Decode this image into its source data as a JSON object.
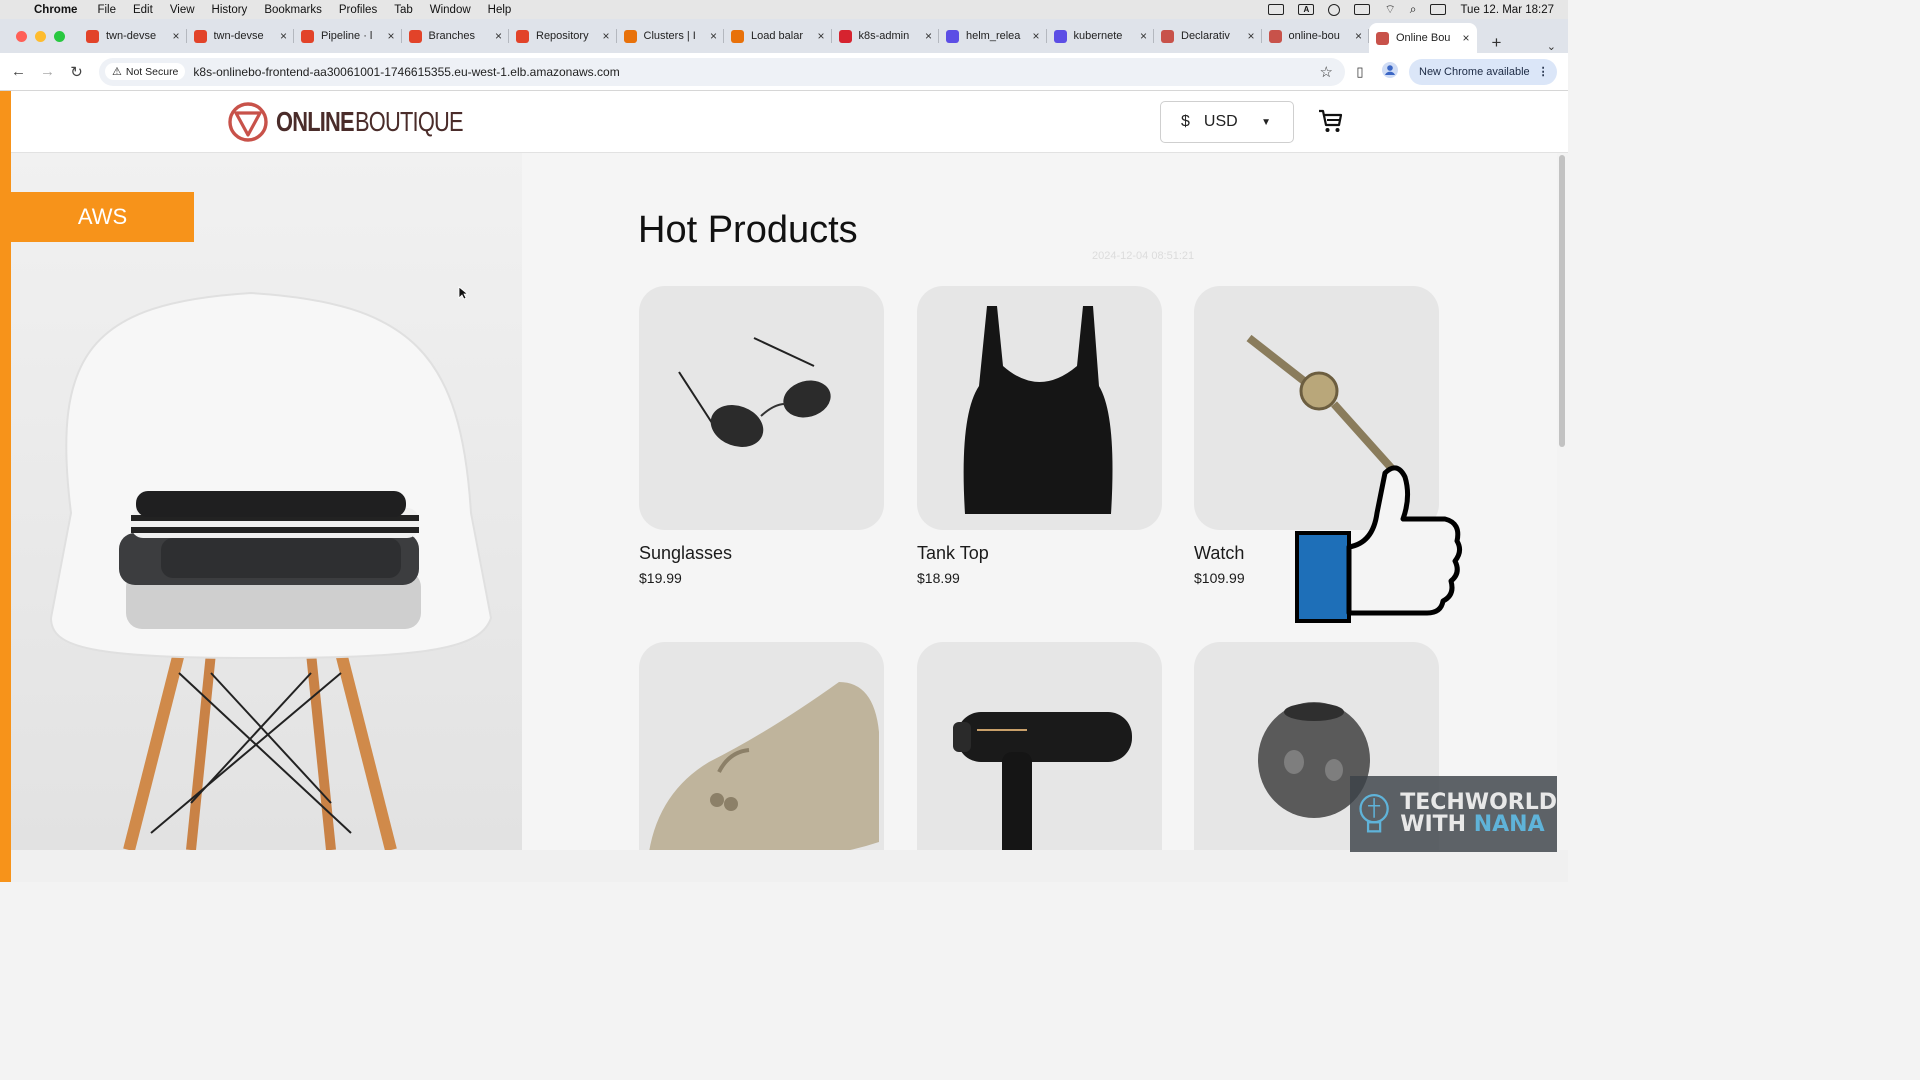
{
  "menubar": {
    "app": "Chrome",
    "items": [
      "File",
      "Edit",
      "View",
      "History",
      "Bookmarks",
      "Profiles",
      "Tab",
      "Window",
      "Help"
    ],
    "clock": "Tue 12. Mar  18:27"
  },
  "tabs": [
    {
      "title": "twn-devse",
      "favicon": "gitlab-icon",
      "color": "#e24329"
    },
    {
      "title": "twn-devse",
      "favicon": "gitlab-icon",
      "color": "#e24329"
    },
    {
      "title": "Pipeline · l",
      "favicon": "gitlab-icon",
      "color": "#e24329"
    },
    {
      "title": "Branches",
      "favicon": "gitlab-icon",
      "color": "#e24329"
    },
    {
      "title": "Repository",
      "favicon": "gitlab-icon",
      "color": "#e24329"
    },
    {
      "title": "Clusters | I",
      "favicon": "aws-icon",
      "color": "#e8710a"
    },
    {
      "title": "Load balar",
      "favicon": "aws-icon",
      "color": "#e8710a"
    },
    {
      "title": "k8s-admin",
      "favicon": "aws-iam-icon",
      "color": "#d6232f"
    },
    {
      "title": "helm_relea",
      "favicon": "terraform-icon",
      "color": "#5c4ee5"
    },
    {
      "title": "kubernete",
      "favicon": "terraform-icon",
      "color": "#5c4ee5"
    },
    {
      "title": "Declarativ",
      "favicon": "online-boutique-icon",
      "color": "#c8524a"
    },
    {
      "title": "online-bou",
      "favicon": "online-boutique-icon",
      "color": "#c8524a"
    },
    {
      "title": "Online Bou",
      "favicon": "online-boutique-icon",
      "color": "#c8524a",
      "active": true
    }
  ],
  "address": {
    "security": "Not Secure",
    "url": "k8s-onlinebo-frontend-aa30061001-1746615355.eu-west-1.elb.amazonaws.com",
    "new_chrome": "New Chrome available"
  },
  "site": {
    "logo_bold": "ONLINE",
    "logo_light": "BOUTIQUE",
    "currency_symbol": "$",
    "currency": "USD",
    "badge": "AWS",
    "section_title": "Hot Products",
    "timestamp": "2024-12-04 08:51:21"
  },
  "products": [
    {
      "name": "Sunglasses",
      "price": "$19.99"
    },
    {
      "name": "Tank Top",
      "price": "$18.99"
    },
    {
      "name": "Watch",
      "price": "$109.99"
    },
    {
      "name": "",
      "price": ""
    },
    {
      "name": "",
      "price": ""
    },
    {
      "name": "",
      "price": ""
    }
  ],
  "watermark": {
    "line1": "TECHWORLD",
    "line2a": "WITH ",
    "line2b": "NANA"
  },
  "colors": {
    "accent": "#f7931a",
    "brand": "#c8524a",
    "brand_text": "#4a2c2a"
  }
}
